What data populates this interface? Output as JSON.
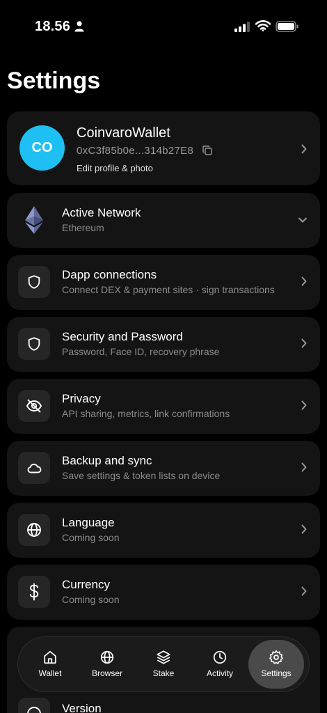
{
  "status_bar": {
    "time": "18.56"
  },
  "page": {
    "title": "Settings"
  },
  "profile": {
    "initials": "CO",
    "name": "CoinvaroWallet",
    "address": "0xC3f85b0e...314b27E8",
    "edit_label": "Edit profile & photo",
    "avatar_color": "#1ec0f4"
  },
  "settings": [
    {
      "title": "Active Network",
      "subtitle": "Ethereum",
      "icon": "ethereum-icon"
    },
    {
      "title": "Dapp connections",
      "subtitle": "Connect DEX & payment sites · sign transactions",
      "icon": "shield-icon"
    },
    {
      "title": "Security and Password",
      "subtitle": "Password, Face ID, recovery phrase",
      "icon": "shield-icon"
    },
    {
      "title": "Privacy",
      "subtitle": "API sharing, metrics, link confirmations",
      "icon": "eye-off-icon"
    },
    {
      "title": "Backup and sync",
      "subtitle": "Save settings & token lists on device",
      "icon": "cloud-icon"
    },
    {
      "title": "Language",
      "subtitle": "Coming soon",
      "icon": "globe-icon"
    },
    {
      "title": "Currency",
      "subtitle": "Coming soon",
      "icon": "dollar-icon"
    },
    {
      "title": "Version",
      "icon": "info-icon"
    }
  ],
  "nav": [
    {
      "label": "Wallet",
      "icon": "home-icon"
    },
    {
      "label": "Browser",
      "icon": "globe-icon"
    },
    {
      "label": "Stake",
      "icon": "layers-icon"
    },
    {
      "label": "Activity",
      "icon": "clock-icon"
    },
    {
      "label": "Settings",
      "icon": "gear-icon",
      "active": true
    }
  ],
  "colors": {
    "background": "#000000",
    "card": "#141414",
    "icon_box": "#262626",
    "nav_active": "#4a4a4a"
  }
}
